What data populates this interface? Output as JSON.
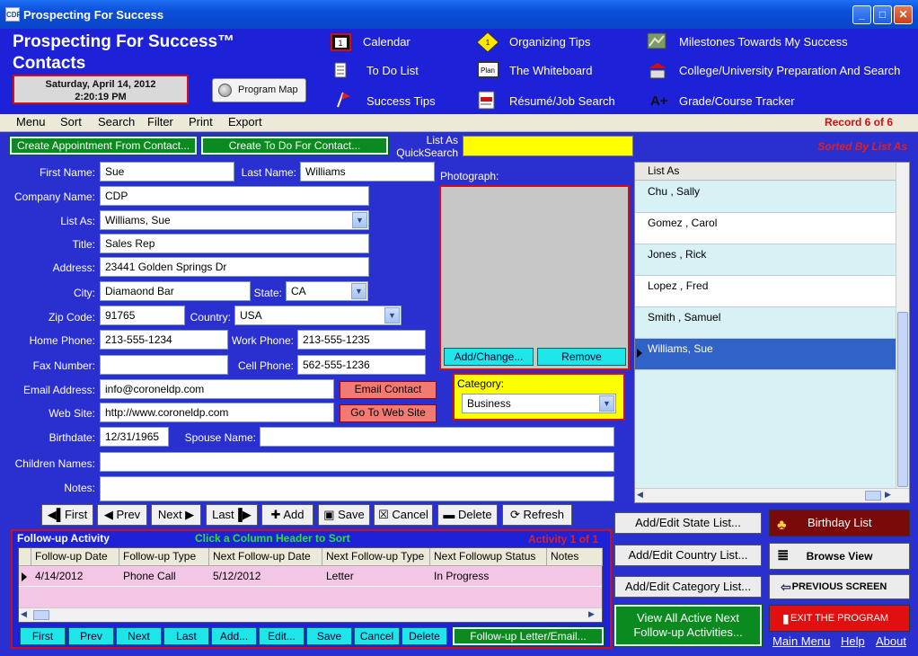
{
  "window": {
    "title": "Prospecting For Success",
    "icon_text": "CDP"
  },
  "header": {
    "app_title_line1": "Prospecting For Success™",
    "app_title_line2": "Contacts",
    "date": "Saturday, April 14, 2012",
    "time": "2:20:19 PM",
    "program_map": "Program Map",
    "nav": {
      "col1": [
        "Calendar",
        "To Do List",
        "Success Tips"
      ],
      "col2": [
        "Organizing Tips",
        "The Whiteboard",
        "Résumé/Job Search"
      ],
      "col3": [
        "Milestones Towards My Success",
        "College/University Preparation And Search",
        "Grade/Course Tracker"
      ]
    }
  },
  "menu": {
    "items": [
      "Menu",
      "Sort",
      "Search",
      "Filter",
      "Print",
      "Export"
    ],
    "record": "Record 6 of 6"
  },
  "toolbar": {
    "create_appt": "Create Appointment From Contact...",
    "create_todo": "Create To Do For Contact...",
    "quicksearch_label1": "List As",
    "quicksearch_label2": "QuickSearch",
    "quicksearch_value": "",
    "sorted_by": "Sorted By List As"
  },
  "form": {
    "first_name_label": "First Name:",
    "first_name": "Sue",
    "last_name_label": "Last Name:",
    "last_name": "Williams",
    "company_label": "Company Name:",
    "company": "CDP",
    "list_as_label": "List As:",
    "list_as": "Williams, Sue",
    "title_label": "Title:",
    "title": "Sales Rep",
    "address_label": "Address:",
    "address": "23441 Golden Springs Dr",
    "city_label": "City:",
    "city": "Diamaond Bar",
    "state_label": "State:",
    "state": "CA",
    "zip_label": "Zip Code:",
    "zip": "91765",
    "country_label": "Country:",
    "country": "USA",
    "home_phone_label": "Home Phone:",
    "home_phone": "213-555-1234",
    "work_phone_label": "Work Phone:",
    "work_phone": "213-555-1235",
    "fax_label": "Fax  Number:",
    "fax": "",
    "cell_label": "Cell Phone:",
    "cell": "562-555-1236",
    "email_label": "Email Address:",
    "email": "info@coroneldp.com",
    "email_button": "Email Contact",
    "web_label": "Web Site:",
    "web": "http://www.coroneldp.com",
    "web_button": "Go To Web Site",
    "birthdate_label": "Birthdate:",
    "birthdate": "12/31/1965",
    "spouse_label": "Spouse Name:",
    "spouse": "",
    "children_label": "Children Names:",
    "children": "",
    "notes_label": "Notes:",
    "notes": "",
    "photo_label": "Photograph:",
    "photo_add": "Add/Change...",
    "photo_remove": "Remove",
    "category_label": "Category:",
    "category": "Business"
  },
  "list": {
    "header": "List As",
    "rows": [
      "Chu ,  Sally",
      "Gomez ,  Carol",
      "Jones ,  Rick",
      "Lopez ,  Fred",
      "Smith ,  Samuel",
      "Williams, Sue"
    ],
    "selected_index": 5
  },
  "recordnav": {
    "first": "First",
    "prev": "Prev",
    "next": "Next",
    "last": "Last",
    "add": "Add",
    "save": "Save",
    "cancel": "Cancel",
    "delete": "Delete",
    "refresh": "Refresh"
  },
  "followup": {
    "title": "Follow-up Activity",
    "hint": "Click a Column Header to Sort",
    "count": "Activity 1 of 1",
    "columns": [
      "Follow-up Date",
      "Follow-up Type",
      "Next Follow-up Date",
      "Next Follow-up Type",
      "Next Followup Status",
      "Notes"
    ],
    "rows": [
      [
        "4/14/2012",
        "Phone Call",
        "5/12/2012",
        "Letter",
        "In Progress",
        ""
      ]
    ],
    "buttons": [
      "First",
      "Prev",
      "Next",
      "Last",
      "Add...",
      "Edit...",
      "Save",
      "Cancel",
      "Delete"
    ],
    "letter_button": "Follow-up Letter/Email..."
  },
  "right": {
    "state_list": "Add/Edit State List...",
    "country_list": "Add/Edit Country List...",
    "category_list": "Add/Edit Category List...",
    "view_active_1": "View All Active Next",
    "view_active_2": "Follow-up Activities...",
    "birthday": "Birthday List",
    "browse": "Browse View",
    "previous": "PREVIOUS SCREEN",
    "exit": "EXIT THE PROGRAM",
    "main_menu": "Main Menu",
    "help": "Help",
    "about": "About"
  },
  "colors": {
    "background": "#2a2fd0",
    "accent_red": "#d01010",
    "green": "#0b8a1f",
    "cyan": "#1ee5e8",
    "yellow": "#ffff00"
  }
}
